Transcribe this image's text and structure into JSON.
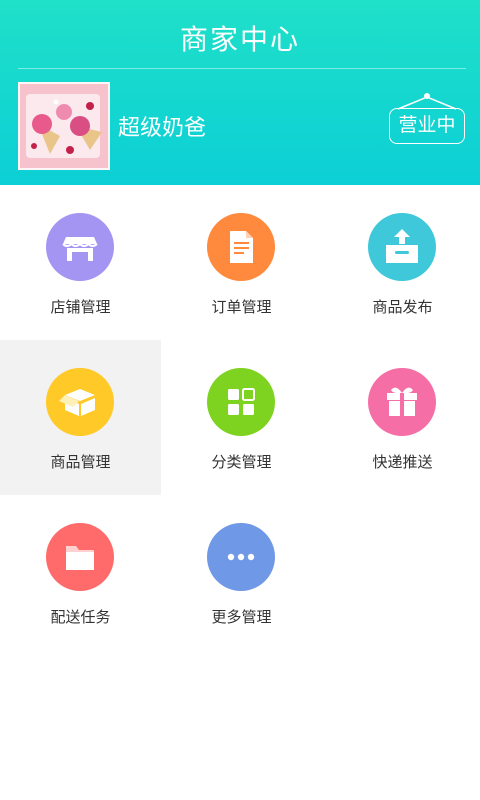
{
  "header": {
    "title": "商家中心",
    "shop_name": "超级奶爸",
    "status": "营业中",
    "bg_top": "#1fe0c8",
    "bg_bottom": "#0ccfd6"
  },
  "menu": [
    {
      "label": "店铺管理",
      "icon": "storefront-icon",
      "color": "#a495f3"
    },
    {
      "label": "订单管理",
      "icon": "document-icon",
      "color": "#ff8a3d"
    },
    {
      "label": "商品发布",
      "icon": "upload-box-icon",
      "color": "#3ec8da"
    },
    {
      "label": "商品管理",
      "icon": "open-box-icon",
      "color": "#ffc927"
    },
    {
      "label": "分类管理",
      "icon": "grid-icon",
      "color": "#7ed321"
    },
    {
      "label": "快递推送",
      "icon": "gift-icon",
      "color": "#f56fa6"
    },
    {
      "label": "配送任务",
      "icon": "folder-icon",
      "color": "#ff6b6b"
    },
    {
      "label": "更多管理",
      "icon": "more-dots-icon",
      "color": "#6f98e6"
    }
  ]
}
